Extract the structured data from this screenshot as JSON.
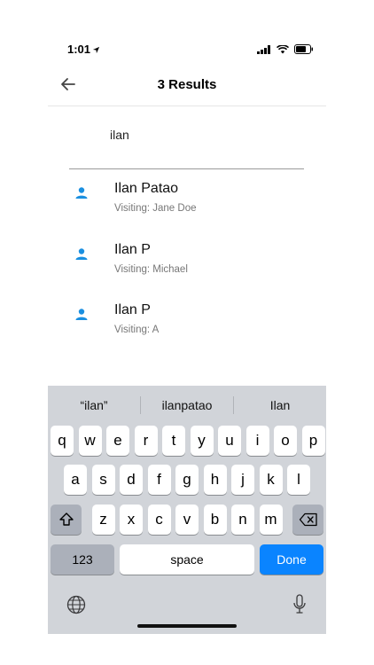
{
  "status": {
    "time": "1:01"
  },
  "header": {
    "title": "3 Results"
  },
  "search": {
    "value": "ilan"
  },
  "results": [
    {
      "name": "Ilan Patao",
      "subtitle": "Visiting: Jane Doe"
    },
    {
      "name": "Ilan P",
      "subtitle": "Visiting: Michael"
    },
    {
      "name": "Ilan P",
      "subtitle": "Visiting: A"
    }
  ],
  "keyboard": {
    "suggestions": [
      "“ilan”",
      "ilanpatao",
      "Ilan"
    ],
    "row1": [
      "q",
      "w",
      "e",
      "r",
      "t",
      "y",
      "u",
      "i",
      "o",
      "p"
    ],
    "row2": [
      "a",
      "s",
      "d",
      "f",
      "g",
      "h",
      "j",
      "k",
      "l"
    ],
    "row3": [
      "z",
      "x",
      "c",
      "v",
      "b",
      "n",
      "m"
    ],
    "numbers_label": "123",
    "space_label": "space",
    "done_label": "Done"
  },
  "icons": {
    "back": "arrow-left-icon",
    "person": "person-icon",
    "shift": "shift-icon",
    "delete": "backspace-icon",
    "globe": "globe-icon",
    "mic": "microphone-icon"
  },
  "colors": {
    "accent": "#1a8fe0",
    "done": "#0a84ff",
    "keyboard_bg": "#d1d4d9"
  }
}
